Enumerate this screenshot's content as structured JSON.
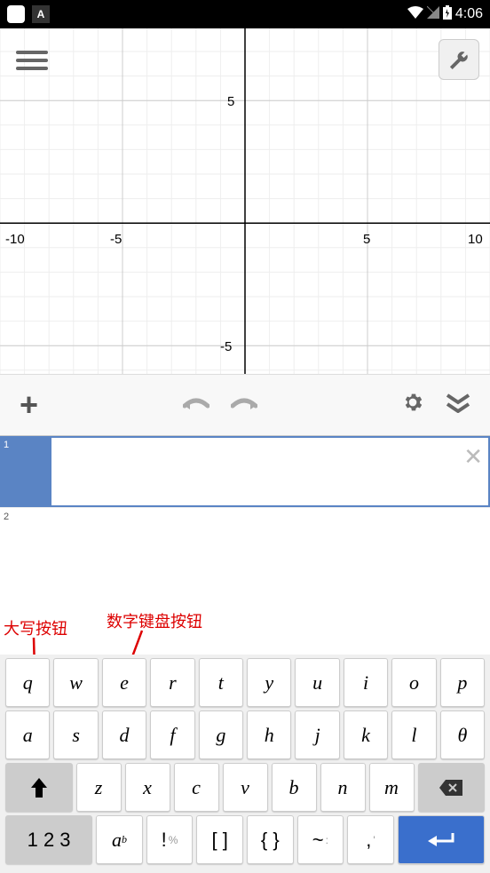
{
  "status": {
    "time": "4:06",
    "a_icon_label": "A"
  },
  "chart_data": {
    "type": "line",
    "series": [],
    "xlabel": "",
    "ylabel": "",
    "xlim": [
      -10,
      10
    ],
    "ylim": [
      -7,
      5.5
    ],
    "x_ticks": [
      -10,
      -5,
      0,
      5,
      10
    ],
    "y_ticks": [
      -5,
      5
    ],
    "grid": true,
    "title": ""
  },
  "expressions": [
    {
      "index": "1",
      "value": "",
      "active": true
    },
    {
      "index": "2",
      "value": "",
      "active": false
    }
  ],
  "annotations": {
    "caps": "大写按钮",
    "numpad": "数字键盘按钮"
  },
  "keyboard": {
    "row1": [
      "q",
      "w",
      "e",
      "r",
      "t",
      "y",
      "u",
      "i",
      "o",
      "p"
    ],
    "row2": [
      "a",
      "s",
      "d",
      "f",
      "g",
      "h",
      "j",
      "k",
      "l",
      "θ"
    ],
    "row3_shift": "⬆",
    "row3": [
      "z",
      "x",
      "c",
      "v",
      "b",
      "n",
      "m"
    ],
    "row3_backspace": "⌫",
    "row4_numpad": "1 2 3",
    "row4_sub_base": "a",
    "row4_sub_sub": "b",
    "row4_exc": "!",
    "row4_pct": "%",
    "row4_brackets": "[  ]",
    "row4_braces": "{  }",
    "row4_tilde": "~",
    "row4_colon": ":",
    "row4_comma": ",",
    "row4_apos": "'",
    "row4_enter": "⏎"
  }
}
